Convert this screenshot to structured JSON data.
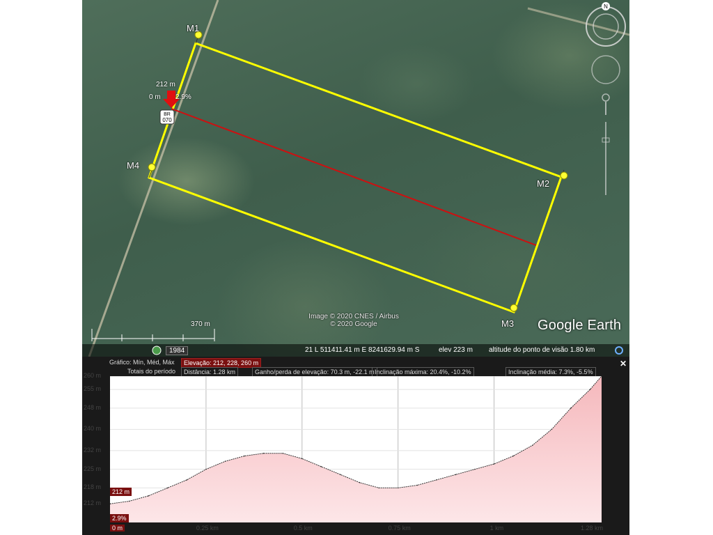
{
  "map": {
    "imagery_credit_line1": "Image © 2020 CNES / Airbus",
    "imagery_credit_line2": "© 2020 Google",
    "logo": "Google Earth",
    "scale_label": "370 m",
    "year_label": "1984",
    "road_shield": {
      "line1": "BR",
      "line2": "070"
    },
    "markers": [
      {
        "label": "M1"
      },
      {
        "label": "M2"
      },
      {
        "label": "M3"
      },
      {
        "label": "M4"
      }
    ],
    "cursor_elevation": "212 m",
    "cursor_distance": "0 m",
    "cursor_slope": "2.9%",
    "line_color": "#ffff00",
    "path_color": "#cc1111"
  },
  "status_bar": {
    "coords": "21 L 511411.41 m E 8241629.94 m S",
    "elevation": "elev  223 m",
    "eye_altitude": "altitude do ponto de visão  1.80 km"
  },
  "profile": {
    "header": {
      "graph_label": "Gráfico: Mín, Méd, Máx",
      "elevation_label": "Elevação: 212, 228, 260 m",
      "totals_label": "Totais do período",
      "distance_label": "Distância: 1.28 km",
      "gain_loss_label": "Ganho/perda de elevação: 70.3 m, -22.1 m",
      "max_slope_label": "Inclinação máxima: 20.4%, -10.2%",
      "avg_slope_label": "Inclinação média: 7.3%, -5.5%"
    },
    "close_icon": "close-icon",
    "cursor_elevation_box": "212 m",
    "cursor_slope_box": "2.9%",
    "cursor_distance_box": "0 m",
    "fill_color": "#f5b8bc"
  },
  "chart_data": {
    "type": "area",
    "xlabel": "",
    "ylabel": "",
    "x": [
      0,
      0.05,
      0.1,
      0.15,
      0.2,
      0.25,
      0.3,
      0.35,
      0.4,
      0.45,
      0.5,
      0.55,
      0.6,
      0.65,
      0.7,
      0.75,
      0.8,
      0.85,
      0.9,
      0.95,
      1.0,
      1.05,
      1.1,
      1.15,
      1.2,
      1.25,
      1.28
    ],
    "series": [
      {
        "values": [
          212,
          213,
          215,
          218,
          221,
          225,
          228,
          230,
          231,
          231,
          229,
          226,
          223,
          220,
          218,
          218,
          219,
          221,
          223,
          225,
          227,
          230,
          234,
          240,
          248,
          255,
          260
        ]
      }
    ],
    "xlim": [
      0,
      1.28
    ],
    "ylim": [
      205,
      260
    ],
    "x_ticks": [
      "0 m",
      "0.25 km",
      "0.5 km",
      "0.75 km",
      "1 km",
      "1.28 km"
    ],
    "y_ticks": [
      "260 m",
      "255 m",
      "248 m",
      "240 m",
      "232 m",
      "225 m",
      "218 m",
      "212 m"
    ],
    "grid": true
  }
}
